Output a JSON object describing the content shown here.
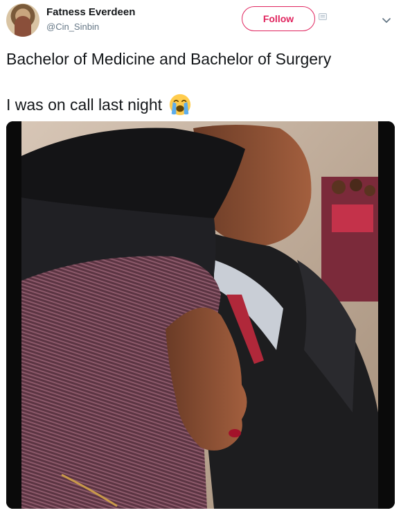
{
  "tweet": {
    "author": {
      "display_name": "Fatness Everdeen",
      "handle": "@Cin_Sinbin",
      "avatar_icon": "profile-photo"
    },
    "follow_label": "Follow",
    "text_lines": [
      "Bachelor of Medicine and Bachelor of Surgery",
      "I was on call last night"
    ],
    "emoji": "loudly-crying-face",
    "media": {
      "kind": "photo",
      "subject": "graduates in black caps and gowns at a ceremony"
    }
  },
  "colors": {
    "follow_accent": "#e0245e",
    "handle_gray": "#657786",
    "text": "#14171a"
  }
}
